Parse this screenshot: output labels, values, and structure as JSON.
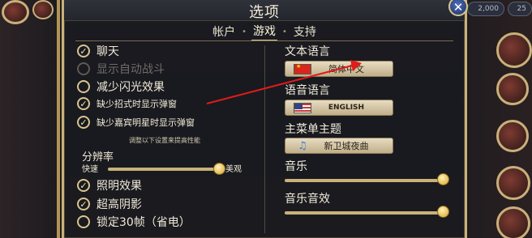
{
  "dialog": {
    "title": "选项",
    "close_label": "✕"
  },
  "tabs": [
    {
      "label": "帐户",
      "active": false
    },
    {
      "label": "游戏",
      "active": true
    },
    {
      "label": "支持",
      "active": false
    }
  ],
  "tab_separator": "•",
  "left": {
    "options": [
      {
        "label": "聊天",
        "checked": true,
        "enabled": true
      },
      {
        "label": "显示自动战斗",
        "checked": false,
        "enabled": false
      },
      {
        "label": "减少闪光效果",
        "checked": false,
        "enabled": true
      },
      {
        "label": "缺少招式时显示弹窗",
        "checked": true,
        "enabled": true
      },
      {
        "label": "缺少嘉宾明星时显示弹窗",
        "checked": true,
        "enabled": true
      }
    ],
    "performance_note": "调整以下设置来提高性能",
    "resolution": {
      "label": "分辨率",
      "left_label": "快速",
      "right_label": "美观",
      "value": 1.0
    },
    "graphics": [
      {
        "label": "照明效果",
        "checked": true
      },
      {
        "label": "超高阴影",
        "checked": true
      },
      {
        "label": "锁定30帧（省电）",
        "checked": false
      }
    ]
  },
  "right": {
    "text_language": {
      "label": "文本语言",
      "value": "简体中文",
      "flag": "flag-china-icon"
    },
    "voice_language": {
      "label": "语音语言",
      "value": "ENGLISH",
      "flag": "flag-usa-icon"
    },
    "main_menu_theme": {
      "label": "主菜单主题",
      "value": "新卫城夜曲",
      "icon": "music-note-icon"
    },
    "music": {
      "label": "音乐",
      "value": 1.0
    },
    "sfx": {
      "label": "音乐音效",
      "value": 1.0
    }
  },
  "hud": {
    "coins": "2,000",
    "gems": "25"
  },
  "colors": {
    "gold": "#c9b27a",
    "annotation_arrow": "#e01b1b",
    "panel": "#1a1b20"
  }
}
